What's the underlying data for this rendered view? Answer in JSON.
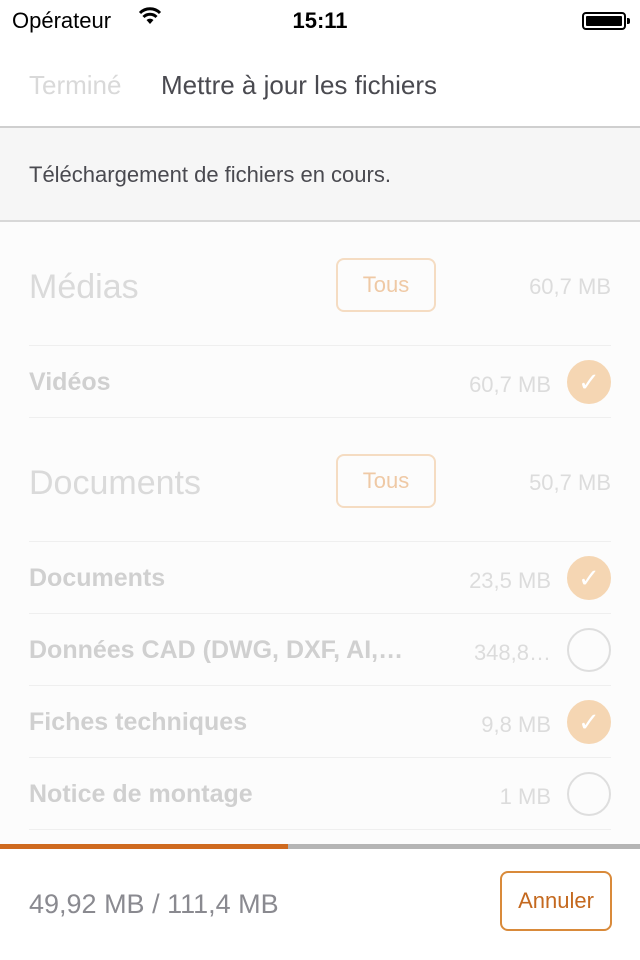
{
  "status_bar": {
    "carrier": "Opérateur",
    "time": "15:11",
    "wifi_icon": "wifi-icon",
    "battery_icon": "battery-full-icon"
  },
  "nav": {
    "done_label": "Terminé",
    "title": "Mettre à jour les fichiers"
  },
  "banner": {
    "text": "Téléchargement de fichiers en cours."
  },
  "sections": [
    {
      "title": "Médias",
      "all_label": "Tous",
      "size": "60,7 MB",
      "items": [
        {
          "label": "Vidéos",
          "size": "60,7 MB",
          "checked": true
        }
      ]
    },
    {
      "title": "Documents",
      "all_label": "Tous",
      "size": "50,7 MB",
      "items": [
        {
          "label": "Documents",
          "size": "23,5 MB",
          "checked": true
        },
        {
          "label": "Données CAD (DWG, DXF, AI,…",
          "size": "348,8…",
          "checked": false
        },
        {
          "label": "Fiches techniques",
          "size": "9,8 MB",
          "checked": true
        },
        {
          "label": "Notice de montage",
          "size": "1 MB",
          "checked": false
        }
      ]
    }
  ],
  "progress": {
    "percent": 45,
    "fill_color": "#cf6a1f",
    "track_color": "#b5b5b5"
  },
  "footer": {
    "amount": "49,92 MB / 111,4 MB",
    "cancel_label": "Annuler"
  },
  "colors": {
    "accent": "#c4691f",
    "check_fill": "#f5d6b3"
  }
}
